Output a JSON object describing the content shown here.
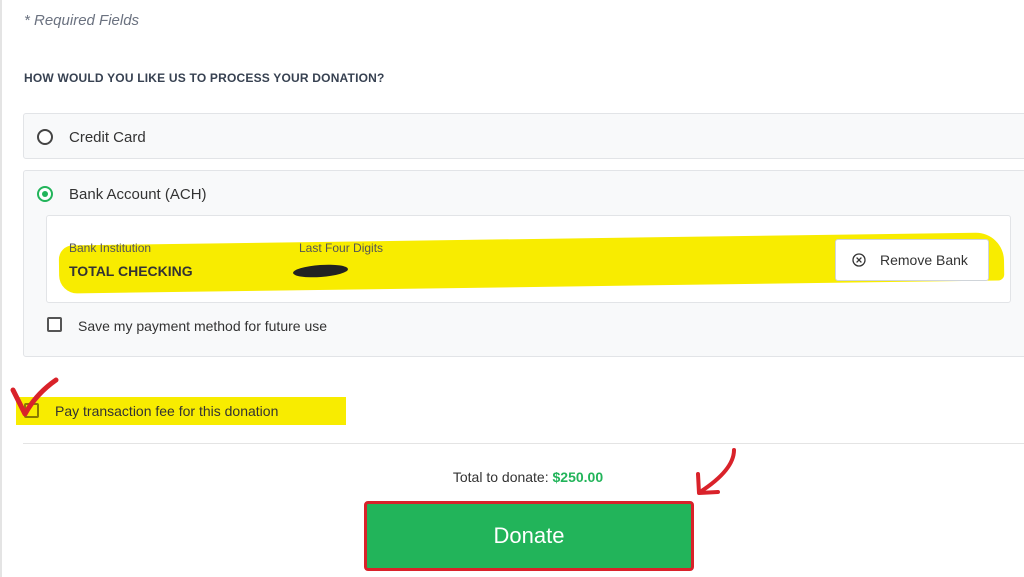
{
  "form": {
    "required_note": "* Required Fields",
    "question": "HOW WOULD YOU LIKE US TO PROCESS YOUR DONATION?"
  },
  "payment_options": {
    "credit_card": {
      "label": "Credit Card",
      "selected": false
    },
    "bank_account": {
      "label": "Bank Account (ACH)",
      "selected": true
    }
  },
  "bank": {
    "institution_label": "Bank Institution",
    "institution_value": "TOTAL CHECKING",
    "last_four_label": "Last Four Digits",
    "last_four_value": "",
    "remove_label": "Remove Bank",
    "remove_icon": "circle-x-icon"
  },
  "save_method": {
    "label": "Save my payment method for future use",
    "checked": false
  },
  "transaction_fee": {
    "label": "Pay transaction fee for this donation",
    "checked": true
  },
  "total": {
    "label": "Total to donate:",
    "amount": "$250.00"
  },
  "donate_button": {
    "label": "Donate"
  },
  "colors": {
    "accent_green": "#22b45a",
    "highlight_yellow": "#f8ec00",
    "annotation_red": "#d9222a"
  }
}
